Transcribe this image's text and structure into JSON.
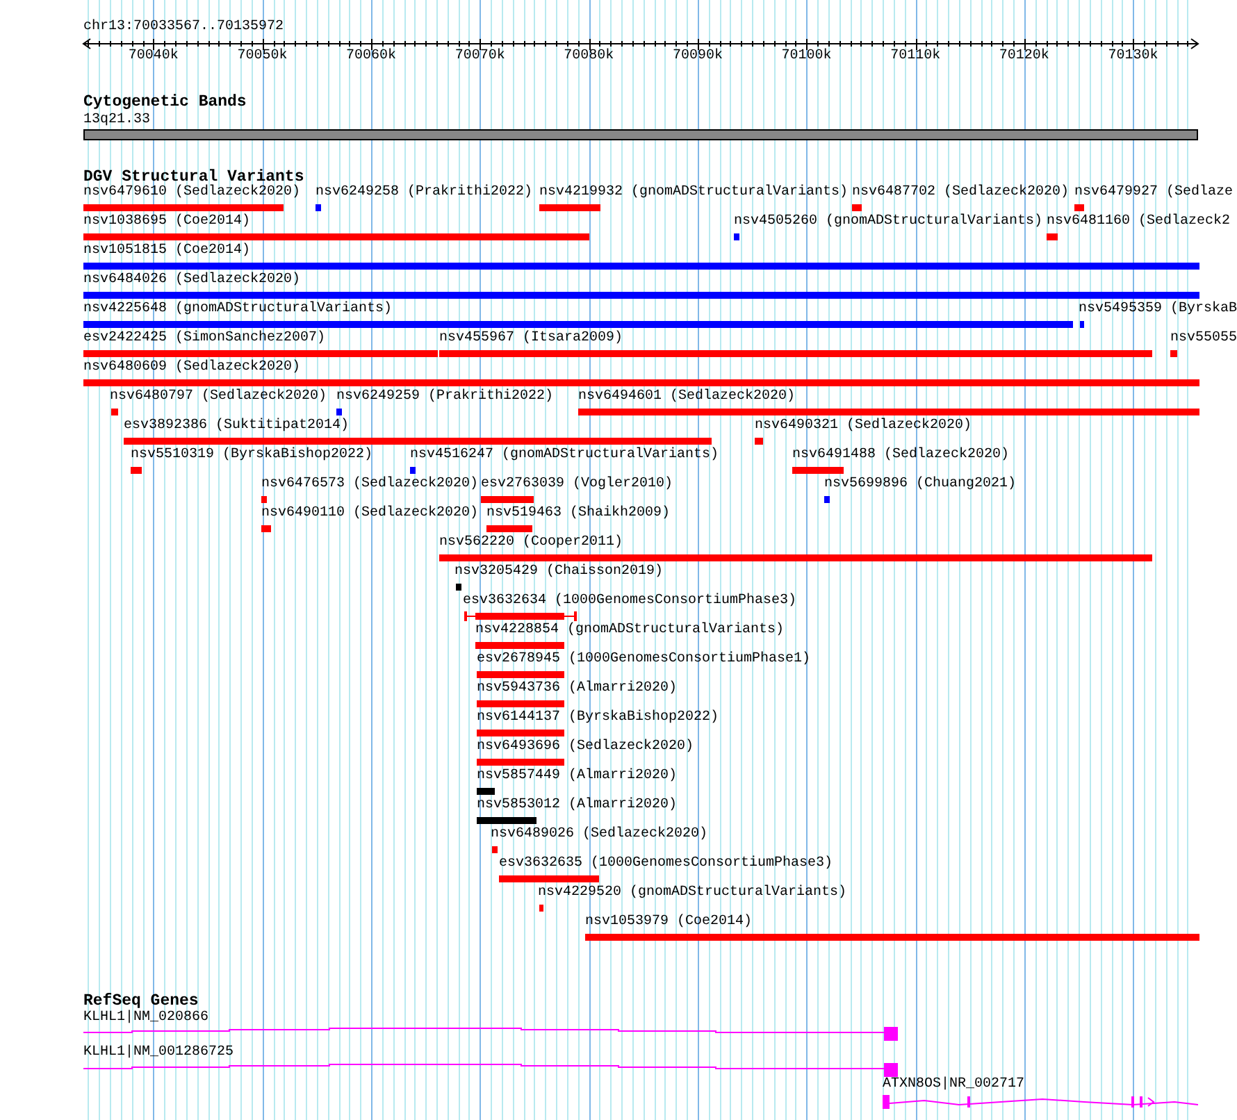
{
  "ruler": {
    "location": "chr13:70033567..70135972",
    "ticks": [
      "70040k",
      "70050k",
      "70060k",
      "70070k",
      "70080k",
      "70090k",
      "70100k",
      "70110k",
      "70120k",
      "70130k"
    ]
  },
  "tracks": [
    {
      "title": "Cytogenetic Bands",
      "kind": "bands",
      "features": [
        {
          "label": "13q21.33"
        }
      ]
    },
    {
      "title": "DGV Structural Variants",
      "kind": "variants",
      "features": [
        {
          "label": "nsv6479610 (Sedlazeck2020)",
          "color": "#ff0000"
        },
        {
          "label": "nsv6249258 (Prakrithi2022)",
          "color": "#0000ff"
        },
        {
          "label": "nsv4219932 (gnomADStructuralVariants)",
          "color": "#ff0000"
        },
        {
          "label": "nsv6487702 (Sedlazeck2020)",
          "color": "#ff0000"
        },
        {
          "label": "nsv6479927 (Sedlaze",
          "color": "#ff0000"
        },
        {
          "label": "nsv1038695 (Coe2014)",
          "color": "#ff0000"
        },
        {
          "label": "nsv4505260 (gnomADStructuralVariants)",
          "color": "#0000ff"
        },
        {
          "label": "nsv6481160 (Sedlazeck2",
          "color": "#ff0000"
        },
        {
          "label": "nsv1051815 (Coe2014)",
          "color": "#0000ff"
        },
        {
          "label": "nsv6484026 (Sedlazeck2020)",
          "color": "#0000ff"
        },
        {
          "label": "nsv4225648 (gnomADStructuralVariants)",
          "color": "#0000ff"
        },
        {
          "label": "nsv5495359 (ByrskaB",
          "color": "#0000ff"
        },
        {
          "label": "esv2422425 (SimonSanchez2007)",
          "color": "#ff0000"
        },
        {
          "label": "nsv455967 (Itsara2009)",
          "color": "#ff0000"
        },
        {
          "label": "nsv55055",
          "color": "#ff0000"
        },
        {
          "label": "nsv6480609 (Sedlazeck2020)",
          "color": "#ff0000"
        },
        {
          "label": "nsv6480797 (Sedlazeck2020)",
          "color": "#ff0000"
        },
        {
          "label": "nsv6249259 (Prakrithi2022)",
          "color": "#0000ff"
        },
        {
          "label": "nsv6494601 (Sedlazeck2020)",
          "color": "#ff0000"
        },
        {
          "label": "esv3892386 (Suktitipat2014)",
          "color": "#ff0000"
        },
        {
          "label": "nsv6490321 (Sedlazeck2020)",
          "color": "#ff0000"
        },
        {
          "label": "nsv5510319 (ByrskaBishop2022)",
          "color": "#ff0000"
        },
        {
          "label": "nsv4516247 (gnomADStructuralVariants)",
          "color": "#0000ff"
        },
        {
          "label": "nsv6491488 (Sedlazeck2020)",
          "color": "#ff0000"
        },
        {
          "label": "nsv6476573 (Sedlazeck2020)",
          "color": "#ff0000"
        },
        {
          "label": "esv2763039 (Vogler2010)",
          "color": "#ff0000"
        },
        {
          "label": "nsv5699896 (Chuang2021)",
          "color": "#0000ff"
        },
        {
          "label": "nsv6490110 (Sedlazeck2020)",
          "color": "#ff0000"
        },
        {
          "label": "nsv519463 (Shaikh2009)",
          "color": "#ff0000"
        },
        {
          "label": "nsv562220 (Cooper2011)",
          "color": "#ff0000"
        },
        {
          "label": "nsv3205429 (Chaisson2019)",
          "color": "#000000"
        },
        {
          "label": "esv3632634 (1000GenomesConsortiumPhase3)",
          "color": "#ff0000"
        },
        {
          "label": "nsv4228854 (gnomADStructuralVariants)",
          "color": "#ff0000"
        },
        {
          "label": "esv2678945 (1000GenomesConsortiumPhase1)",
          "color": "#ff0000"
        },
        {
          "label": "nsv5943736 (Almarri2020)",
          "color": "#ff0000"
        },
        {
          "label": "nsv6144137 (ByrskaBishop2022)",
          "color": "#ff0000"
        },
        {
          "label": "nsv6493696 (Sedlazeck2020)",
          "color": "#ff0000"
        },
        {
          "label": "nsv5857449 (Almarri2020)",
          "color": "#000000"
        },
        {
          "label": "nsv5853012 (Almarri2020)",
          "color": "#000000"
        },
        {
          "label": "nsv6489026 (Sedlazeck2020)",
          "color": "#ff0000"
        },
        {
          "label": "esv3632635 (1000GenomesConsortiumPhase3)",
          "color": "#ff0000"
        },
        {
          "label": "nsv4229520 (gnomADStructuralVariants)",
          "color": "#ff0000"
        },
        {
          "label": "nsv1053979 (Coe2014)",
          "color": "#ff0000"
        }
      ]
    },
    {
      "title": "RefSeq Genes",
      "kind": "genes",
      "features": [
        {
          "label": "KLHL1|NM_020866"
        },
        {
          "label": "KLHL1|NM_001286725"
        },
        {
          "label": "ATXN8OS|NR_002717"
        }
      ]
    }
  ]
}
